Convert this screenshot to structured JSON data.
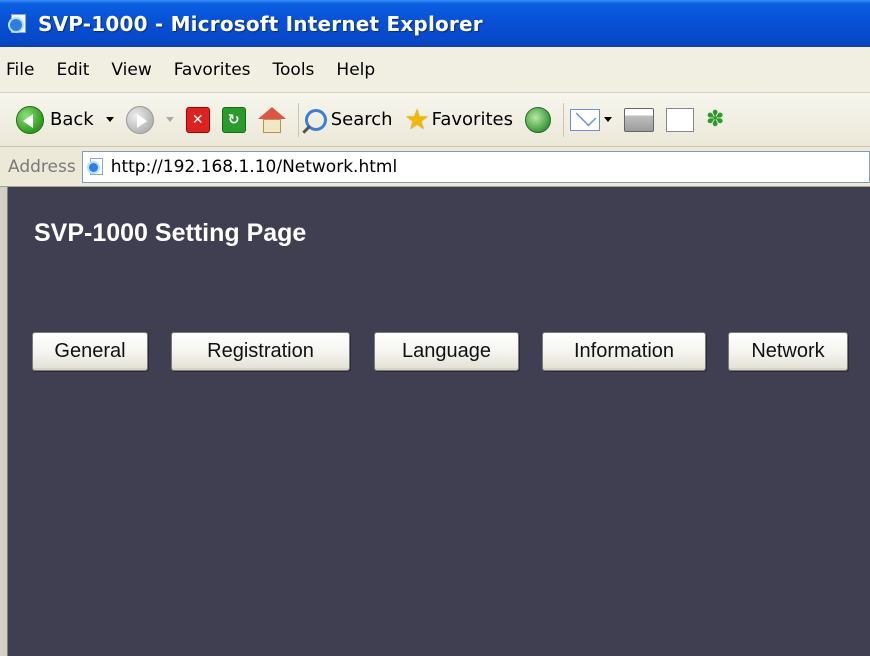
{
  "window": {
    "title": "SVP-1000 - Microsoft Internet Explorer"
  },
  "menu": {
    "items": [
      "File",
      "Edit",
      "View",
      "Favorites",
      "Tools",
      "Help"
    ]
  },
  "toolbar": {
    "back_label": "Back",
    "search_label": "Search",
    "favorites_label": "Favorites"
  },
  "address": {
    "label": "Address",
    "url": "http://192.168.1.10/Network.html"
  },
  "page": {
    "title": "SVP-1000 Setting Page",
    "buttons": [
      "General",
      "Registration",
      "Language",
      "Information",
      "Network"
    ]
  }
}
